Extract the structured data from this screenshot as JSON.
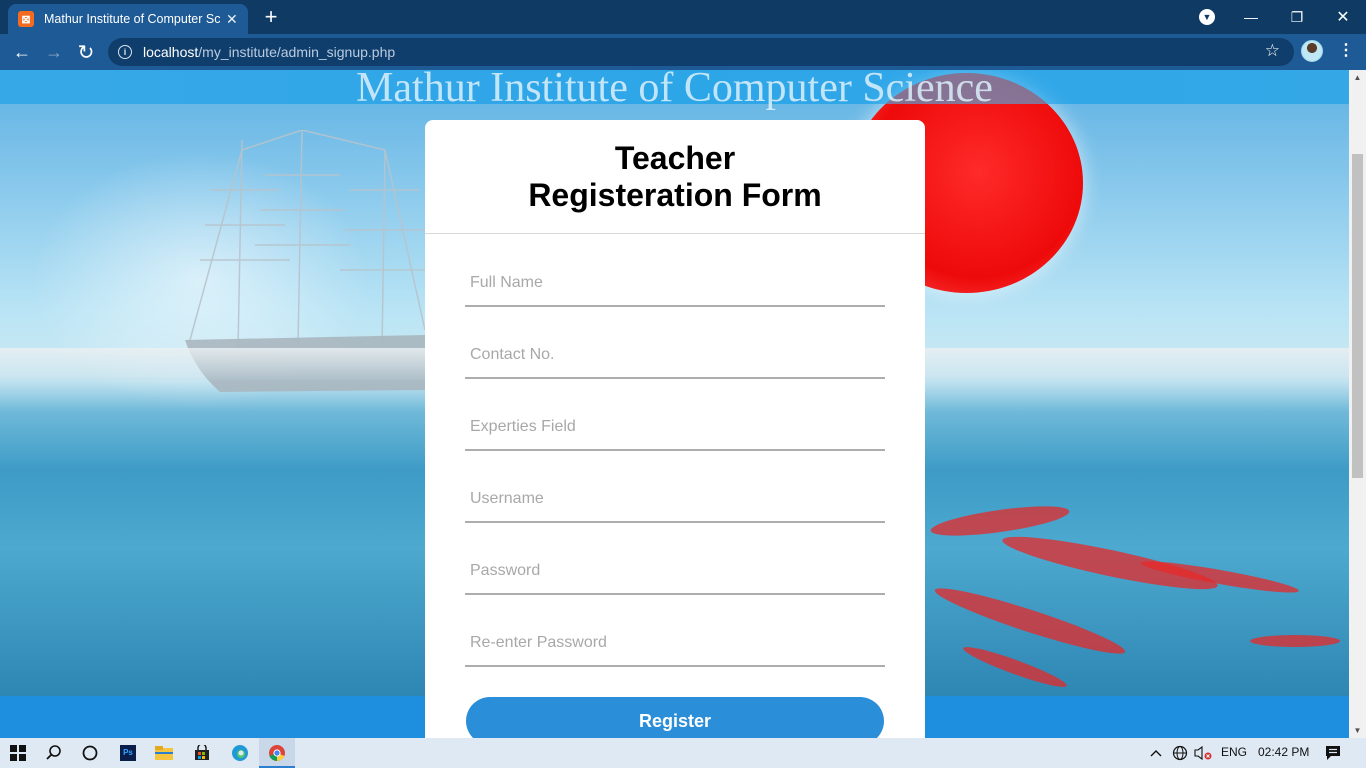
{
  "browser": {
    "tab_title": "Mathur Institute of Computer Science",
    "tab_favicon": "xampp-icon",
    "url_host": "localhost",
    "url_path": "/my_institute/admin_signup.php",
    "icons": {
      "back": "←",
      "forward": "→",
      "reload": "↻",
      "new_tab": "+",
      "close_tab": "✕",
      "minimize": "—",
      "restore": "❐",
      "close_window": "✕",
      "star": "☆",
      "menu": "⋮",
      "profile_dropdown": "▼",
      "info": "i"
    }
  },
  "page": {
    "site_title": "Mathur Institute of Computer Science",
    "form": {
      "title_line1": "Teacher",
      "title_line2": "Registeration Form",
      "fields": [
        {
          "name": "full-name-input",
          "placeholder": "Full Name",
          "value": ""
        },
        {
          "name": "contact-no-input",
          "placeholder": "Contact No.",
          "value": ""
        },
        {
          "name": "experties-field-input",
          "placeholder": "Experties Field",
          "value": ""
        },
        {
          "name": "username-input",
          "placeholder": "Username",
          "value": ""
        },
        {
          "name": "password-input",
          "placeholder": "Password",
          "value": ""
        },
        {
          "name": "reenter-password-input",
          "placeholder": "Re-enter Password",
          "value": ""
        }
      ],
      "submit_label": "Register"
    }
  },
  "taskbar": {
    "language": "ENG",
    "time": "02:42 PM",
    "ps_label": "Ps"
  },
  "colors": {
    "accent": "#2a8ed8",
    "browser_frame": "#0e3a64",
    "toolbar": "#1e5a96",
    "sun": "#ee0a0a"
  }
}
